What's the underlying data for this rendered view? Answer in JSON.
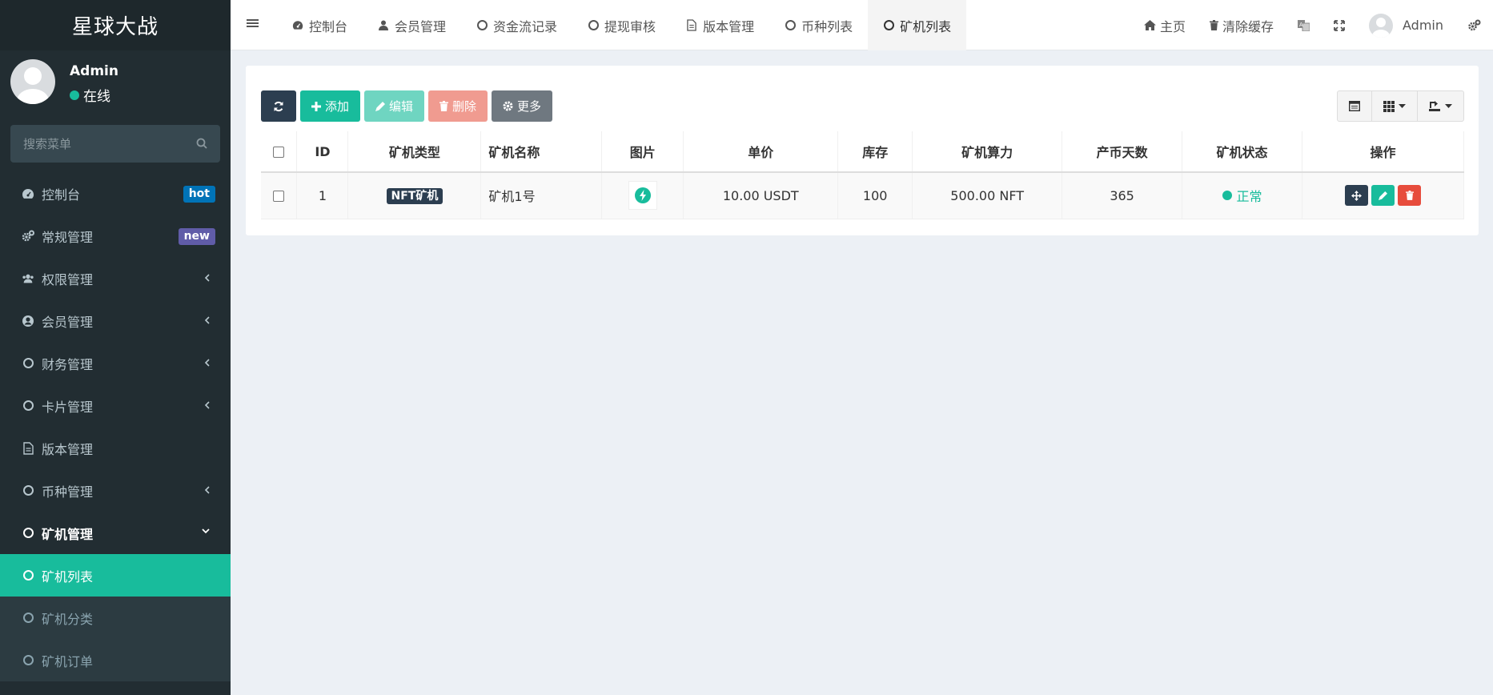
{
  "app": {
    "title": "星球大战"
  },
  "user": {
    "name": "Admin",
    "status": "在线"
  },
  "search": {
    "placeholder": "搜索菜单"
  },
  "sidebar": {
    "items": [
      {
        "label": "控制台",
        "badge": "hot"
      },
      {
        "label": "常规管理",
        "badge": "new"
      },
      {
        "label": "权限管理"
      },
      {
        "label": "会员管理"
      },
      {
        "label": "财务管理"
      },
      {
        "label": "卡片管理"
      },
      {
        "label": "版本管理"
      },
      {
        "label": "币种管理"
      },
      {
        "label": "矿机管理"
      },
      {
        "label": "矿机列表"
      },
      {
        "label": "矿机分类"
      },
      {
        "label": "矿机订单"
      }
    ]
  },
  "topbar": {
    "tabs": [
      {
        "label": "控制台"
      },
      {
        "label": "会员管理"
      },
      {
        "label": "资金流记录"
      },
      {
        "label": "提现审核"
      },
      {
        "label": "版本管理"
      },
      {
        "label": "币种列表"
      },
      {
        "label": "矿机列表"
      }
    ],
    "home": "主页",
    "clear_cache": "清除缓存",
    "user": "Admin"
  },
  "toolbar": {
    "add": "添加",
    "edit": "编辑",
    "delete": "删除",
    "more": "更多"
  },
  "table": {
    "headers": [
      "ID",
      "矿机类型",
      "矿机名称",
      "图片",
      "单价",
      "库存",
      "矿机算力",
      "产币天数",
      "矿机状态",
      "操作"
    ],
    "rows": [
      {
        "id": "1",
        "type": "NFT矿机",
        "name": "矿机1号",
        "price": "10.00 USDT",
        "stock": "100",
        "power": "500.00 NFT",
        "days": "365",
        "status": "正常"
      }
    ]
  },
  "colors": {
    "accent": "#18bc9c",
    "sidebar_bg": "#222d32",
    "dark": "#2c3e50",
    "danger": "#e74c3c",
    "hot_badge": "#0073b7",
    "new_badge": "#605ca8"
  }
}
